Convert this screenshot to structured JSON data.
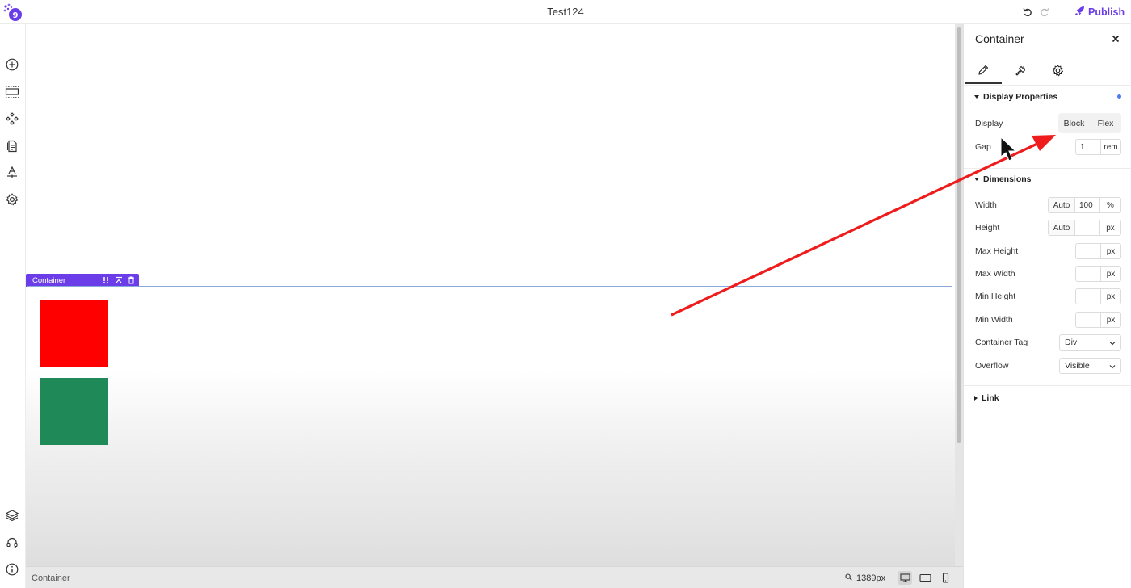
{
  "app": {
    "title": "Test124",
    "publish_label": "Publish"
  },
  "left_sidebar": {
    "top_icons": [
      "plus-circle-icon",
      "section-icon",
      "components-icon",
      "pages-icon",
      "typography-icon",
      "settings-icon"
    ],
    "bottom_icons": [
      "layers-icon",
      "support-icon",
      "info-icon"
    ]
  },
  "canvas": {
    "selected_label": "Container",
    "squares": [
      {
        "name": "red",
        "color": "#ff0000"
      },
      {
        "name": "green",
        "color": "#1f8a58"
      }
    ]
  },
  "status_bar": {
    "breadcrumb": "Container",
    "width_readout": "1389px",
    "devices": [
      "desktop",
      "tablet",
      "mobile"
    ]
  },
  "panel": {
    "title": "Container",
    "tabs": [
      "pencil-icon",
      "brush-icon",
      "gear-icon"
    ],
    "display_section": {
      "title": "Display Properties",
      "display_label": "Display",
      "display_options": [
        "Block",
        "Flex"
      ],
      "gap_label": "Gap",
      "gap_value": "1",
      "gap_unit": "rem"
    },
    "dimensions_section": {
      "title": "Dimensions",
      "rows": [
        {
          "label": "Width",
          "auto": "Auto",
          "value": "100",
          "unit": "%"
        },
        {
          "label": "Height",
          "auto": "Auto",
          "value": "",
          "unit": "px"
        },
        {
          "label": "Max Height",
          "value": "",
          "unit": "px"
        },
        {
          "label": "Max Width",
          "value": "",
          "unit": "px"
        },
        {
          "label": "Min Height",
          "value": "",
          "unit": "px"
        },
        {
          "label": "Min Width",
          "value": "",
          "unit": "px"
        }
      ],
      "container_tag_label": "Container Tag",
      "container_tag_value": "Div",
      "overflow_label": "Overflow",
      "overflow_value": "Visible"
    },
    "link_section": {
      "title": "Link"
    }
  },
  "colors": {
    "accent": "#6a3de8",
    "annotation_arrow": "#ee1c1c",
    "selection_border": "#8ba6db"
  }
}
